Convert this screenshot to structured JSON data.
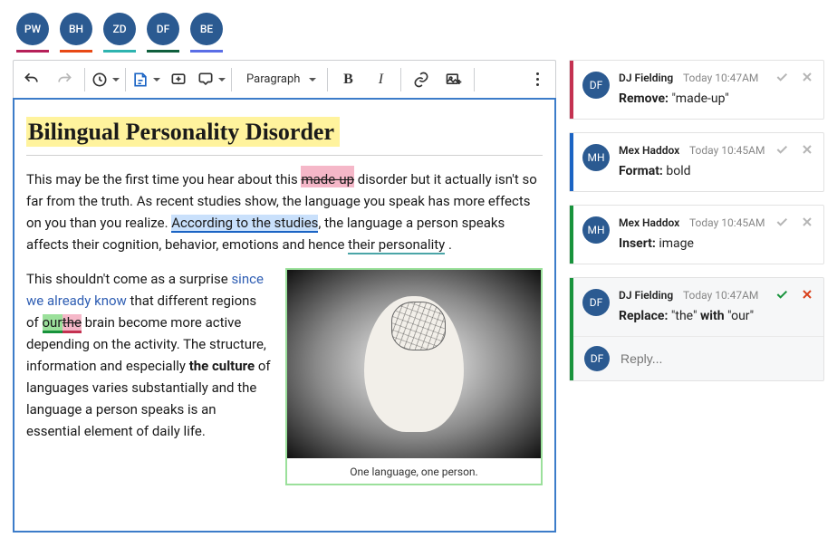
{
  "collaborators": [
    {
      "initials": "PW",
      "color": "#b62059"
    },
    {
      "initials": "BH",
      "color": "#e84915"
    },
    {
      "initials": "ZD",
      "color": "#2eb4b0"
    },
    {
      "initials": "DF",
      "color": "#0f5f3d"
    },
    {
      "initials": "BE",
      "color": "#5a6ee6"
    }
  ],
  "toolbar": {
    "heading_selector": "Paragraph"
  },
  "document": {
    "title": "Bilingual Personality Disorder",
    "p1_a": "This may be the first time you hear about this ",
    "p1_del": "made-up",
    "p1_b": " disorder but it actually isn't so far from the truth. As recent studies show, the language you speak has more effects on you than you realize. ",
    "p1_fmt": "According to the studies",
    "p1_c": ", the language a person speaks affects their cognition, behavior, emotions and hence ",
    "p1_ins": "their personality",
    "p1_d": " .",
    "p2_a": "This shouldn't come as a surprise ",
    "p2_link": "since we already know",
    "p2_b": " that different regions of ",
    "p2_rep_new": "our",
    "p2_rep_old": "the",
    "p2_c": " brain become more active depending on the activity. The structure, information and especially ",
    "p2_bold": "the culture",
    "p2_d": " of languages varies substantially and the language a person speaks is an essential element of daily life.",
    "figure_caption": "One language, one person."
  },
  "comments": [
    {
      "stripe": "#c43251",
      "initials": "DF",
      "name": "DJ Fielding",
      "time": "Today 10:47AM",
      "action_label": "Remove:",
      "action_value": "\"made-up\"",
      "active": false
    },
    {
      "stripe": "#1b64c4",
      "initials": "MH",
      "name": "Mex Haddox",
      "time": "Today 10:45AM",
      "action_label": "Format:",
      "action_value": "bold",
      "active": false
    },
    {
      "stripe": "#18933c",
      "initials": "MH",
      "name": "Mex Haddox",
      "time": "Today 10:45AM",
      "action_label": "Insert:",
      "action_value": "image",
      "active": false
    },
    {
      "stripe": "#18933c",
      "initials": "DF",
      "name": "DJ Fielding",
      "time": "Today 10:47AM",
      "action_label": "Replace:",
      "action_value_a": "\"the\"",
      "action_mid": " with ",
      "action_value_b": "\"our\"",
      "active": true
    }
  ],
  "reply": {
    "initials": "DF",
    "placeholder": "Reply..."
  }
}
